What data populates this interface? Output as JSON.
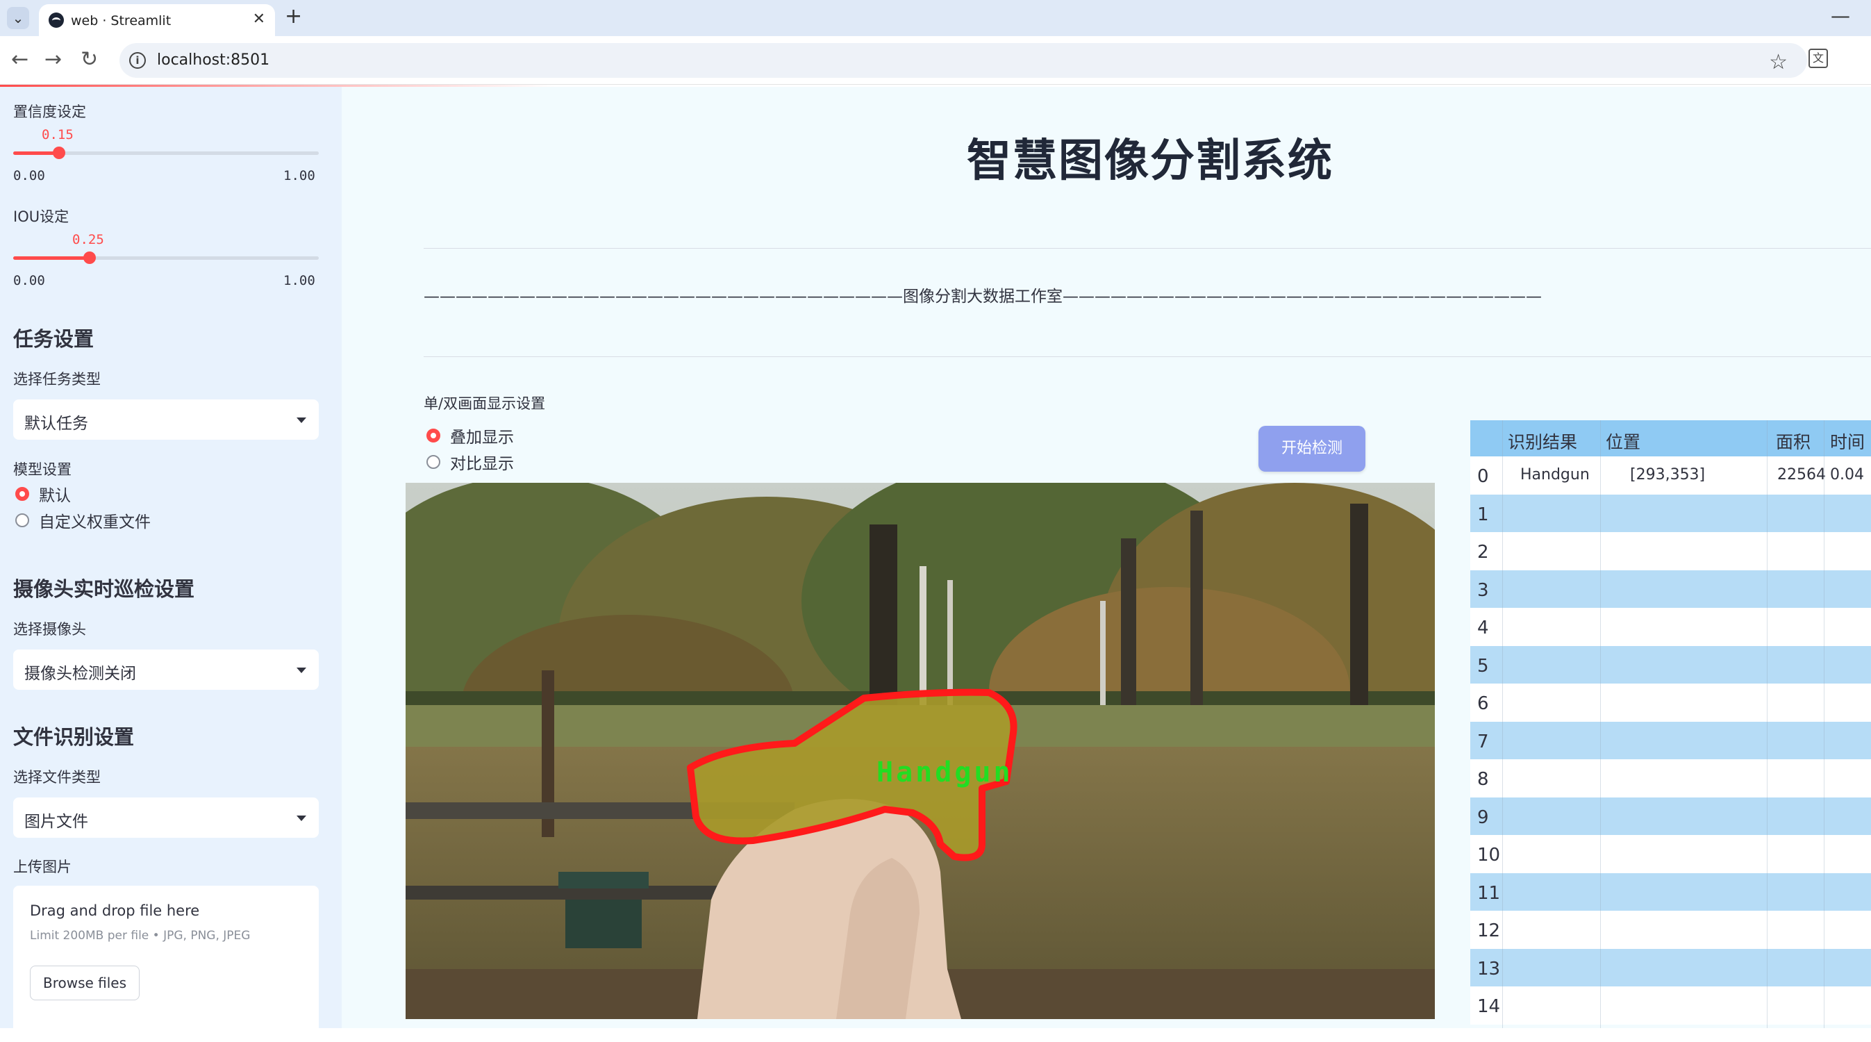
{
  "browser": {
    "tab_title": "web · Streamlit",
    "url": "localhost:8501"
  },
  "sidebar": {
    "confidence": {
      "label": "置信度设定",
      "value": "0.15",
      "min": "0.00",
      "max": "1.00",
      "fraction": 0.15
    },
    "iou": {
      "label": "IOU设定",
      "value": "0.25",
      "min": "0.00",
      "max": "1.00",
      "fraction": 0.25
    },
    "task_section": {
      "heading": "任务设置",
      "select_label": "选择任务类型",
      "selected": "默认任务"
    },
    "model_section": {
      "label": "模型设置",
      "options": [
        "默认",
        "自定义权重文件"
      ],
      "selected_index": 0
    },
    "camera_section": {
      "heading": "摄像头实时巡检设置",
      "select_label": "选择摄像头",
      "selected": "摄像头检测关闭"
    },
    "file_section": {
      "heading": "文件识别设置",
      "select_label": "选择文件类型",
      "selected": "图片文件"
    },
    "upload": {
      "label": "上传图片",
      "title": "Drag and drop file here",
      "limit": "Limit 200MB per file • JPG, PNG, JPEG",
      "browse": "Browse files"
    }
  },
  "main": {
    "title": "智慧图像分割系统",
    "banner": "——————————————————————————————图像分割大数据工作室——————————————————————————————",
    "display_mode": {
      "label": "单/双画面显示设置",
      "options": [
        "叠加显示",
        "对比显示"
      ],
      "selected_index": 0
    },
    "start_button": "开始检测",
    "detection_label": "Handgun"
  },
  "results_table": {
    "columns": [
      "识别结果",
      "位置",
      "面积",
      "时间"
    ],
    "row_indices": [
      "0",
      "1",
      "2",
      "3",
      "4",
      "5",
      "6",
      "7",
      "8",
      "9",
      "10",
      "11",
      "12",
      "13",
      "14"
    ],
    "rows": [
      {
        "result": "Handgun",
        "position": "[293,353]",
        "area": "22564",
        "time": "0.04"
      }
    ]
  },
  "colors": {
    "accent": "#ff4b4b",
    "sidebar_bg": "#e8f2fd",
    "main_bg": "#f2fbfe",
    "button": "#8fa0ee",
    "table_header": "#8fcaf3",
    "table_stripe": "#b6dcf6",
    "mask_outline": "#ff1a1a",
    "mask_fill": "#a89a2a",
    "label_text": "#22dd22"
  }
}
